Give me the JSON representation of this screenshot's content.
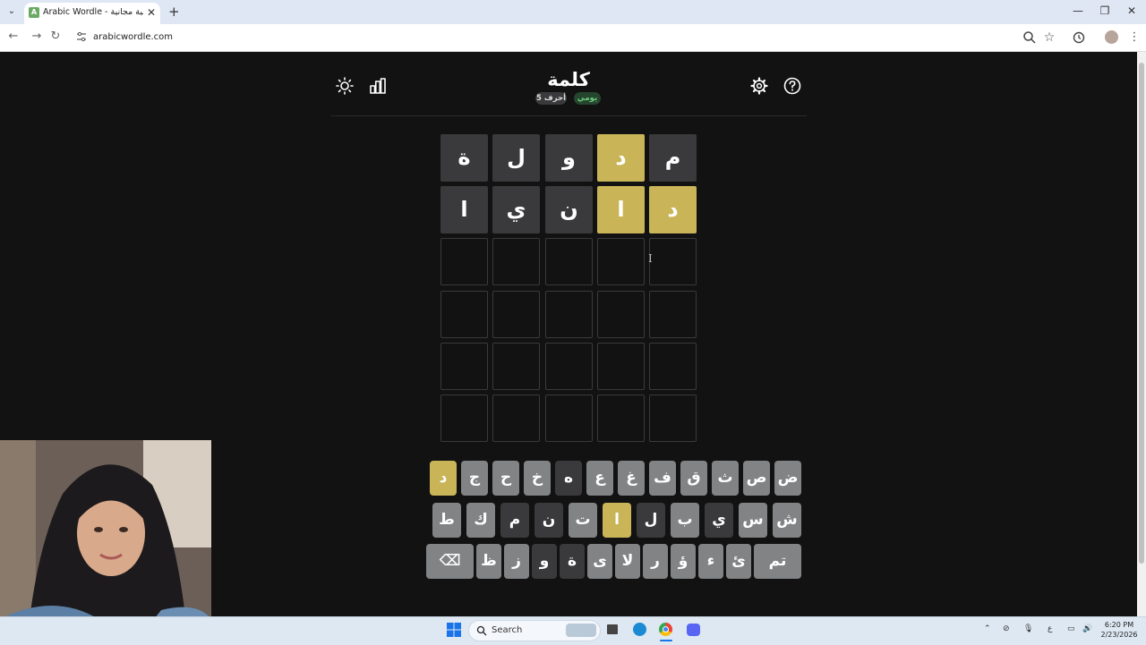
{
  "browser": {
    "tab_title": "Arabic Wordle - لعبة كلمات عربية مجانية",
    "url": "arabicwordle.com",
    "window_controls": [
      "—",
      "❐",
      "✕"
    ]
  },
  "game": {
    "title": "كلمة",
    "word_length_badge": "5 أحرف",
    "mode_badge": "يومي",
    "board": [
      [
        {
          "l": "م",
          "s": "absent"
        },
        {
          "l": "د",
          "s": "present"
        },
        {
          "l": "و",
          "s": "absent"
        },
        {
          "l": "ل",
          "s": "absent"
        },
        {
          "l": "ة",
          "s": "absent"
        }
      ],
      [
        {
          "l": "د",
          "s": "present"
        },
        {
          "l": "ا",
          "s": "present"
        },
        {
          "l": "ن",
          "s": "absent"
        },
        {
          "l": "ي",
          "s": "absent"
        },
        {
          "l": "ا",
          "s": "absent"
        }
      ],
      [
        {
          "l": "",
          "s": "empty"
        },
        {
          "l": "",
          "s": "empty"
        },
        {
          "l": "",
          "s": "empty"
        },
        {
          "l": "",
          "s": "empty"
        },
        {
          "l": "",
          "s": "empty"
        }
      ],
      [
        {
          "l": "",
          "s": "empty"
        },
        {
          "l": "",
          "s": "empty"
        },
        {
          "l": "",
          "s": "empty"
        },
        {
          "l": "",
          "s": "empty"
        },
        {
          "l": "",
          "s": "empty"
        }
      ],
      [
        {
          "l": "",
          "s": "empty"
        },
        {
          "l": "",
          "s": "empty"
        },
        {
          "l": "",
          "s": "empty"
        },
        {
          "l": "",
          "s": "empty"
        },
        {
          "l": "",
          "s": "empty"
        }
      ],
      [
        {
          "l": "",
          "s": "empty"
        },
        {
          "l": "",
          "s": "empty"
        },
        {
          "l": "",
          "s": "empty"
        },
        {
          "l": "",
          "s": "empty"
        },
        {
          "l": "",
          "s": "empty"
        }
      ]
    ],
    "keyboard": [
      [
        {
          "k": "ض",
          "s": "unused"
        },
        {
          "k": "ص",
          "s": "unused"
        },
        {
          "k": "ث",
          "s": "unused"
        },
        {
          "k": "ق",
          "s": "unused"
        },
        {
          "k": "ف",
          "s": "unused"
        },
        {
          "k": "غ",
          "s": "unused"
        },
        {
          "k": "ع",
          "s": "unused"
        },
        {
          "k": "ه",
          "s": "absent"
        },
        {
          "k": "خ",
          "s": "unused"
        },
        {
          "k": "ح",
          "s": "unused"
        },
        {
          "k": "ج",
          "s": "unused"
        },
        {
          "k": "د",
          "s": "present"
        }
      ],
      [
        {
          "k": "ش",
          "s": "unused"
        },
        {
          "k": "س",
          "s": "unused"
        },
        {
          "k": "ي",
          "s": "absent"
        },
        {
          "k": "ب",
          "s": "unused"
        },
        {
          "k": "ل",
          "s": "absent"
        },
        {
          "k": "ا",
          "s": "present"
        },
        {
          "k": "ت",
          "s": "unused"
        },
        {
          "k": "ن",
          "s": "absent"
        },
        {
          "k": "م",
          "s": "absent"
        },
        {
          "k": "ك",
          "s": "unused"
        },
        {
          "k": "ط",
          "s": "unused"
        }
      ],
      [
        {
          "k": "تم",
          "s": "unused",
          "wide": true
        },
        {
          "k": "ئ",
          "s": "unused"
        },
        {
          "k": "ء",
          "s": "unused"
        },
        {
          "k": "ؤ",
          "s": "unused"
        },
        {
          "k": "ر",
          "s": "unused"
        },
        {
          "k": "لا",
          "s": "unused"
        },
        {
          "k": "ى",
          "s": "unused"
        },
        {
          "k": "ة",
          "s": "absent"
        },
        {
          "k": "و",
          "s": "absent"
        },
        {
          "k": "ز",
          "s": "unused"
        },
        {
          "k": "ظ",
          "s": "unused"
        },
        {
          "k": "⌫",
          "s": "unused",
          "wide": true
        }
      ]
    ]
  },
  "taskbar": {
    "search_label": "Search",
    "clock_time": "6:20 PM",
    "clock_date": "2/23/2026",
    "ime_indicator": "ع"
  },
  "colors": {
    "present": "#c9b458",
    "absent": "#3a3a3c",
    "unused": "#818384",
    "background": "#121212"
  }
}
